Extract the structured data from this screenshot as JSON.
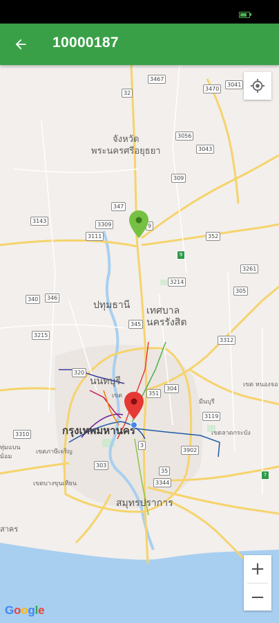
{
  "app_bar": {
    "title": "10000187",
    "back_icon": "arrow-back-icon",
    "color": "#3aa047"
  },
  "map": {
    "province_label": [
      "จังหวัด",
      "พระนครศรีอยุธยา"
    ],
    "city_labels": {
      "pathum_thani": "ปทุมธานี",
      "nakhon_rangsit": [
        "เทศบาล",
        "นครรังสิต"
      ],
      "nonthaburi": "นนทบุรี",
      "bangkok": "กรุงเทพมหานคร",
      "samut_prakan": "สมุทรปราการ",
      "phasi_charoen": "เขตภาษีเจริญ",
      "bang_khun_thian": "เขตบางขุนเทียน",
      "krathum_baen": [
        "ทุ่มแบน",
        "ม้อม"
      ],
      "sakhon": "สาคร",
      "nong_chok": "เขต หนองจอ",
      "lat_krabang": "เขตลาดกระบัง",
      "min_buri": "มีนบุรี",
      "bang_bua": "เขต"
    },
    "road_shields": [
      "3467",
      "3470",
      "3041",
      "32",
      "3056",
      "3043",
      "309",
      "347",
      "3309",
      "3111",
      "3143",
      "9",
      "352",
      "9",
      "3214",
      "3261",
      "305",
      "340",
      "346",
      "345",
      "3215",
      "3312",
      "320",
      "351",
      "304",
      "3119",
      "3310",
      "3902",
      "303",
      "3344",
      "35",
      "7",
      "3"
    ],
    "pins": [
      {
        "name": "green-pin",
        "color": "#76c043"
      },
      {
        "name": "red-pin",
        "color": "#e53935"
      }
    ],
    "current_location_color": "#4285f4"
  },
  "controls": {
    "my_location_icon": "crosshair-icon",
    "zoom_in": "+",
    "zoom_out": "−"
  },
  "attribution": {
    "letters": [
      "G",
      "o",
      "o",
      "g",
      "l",
      "e"
    ]
  }
}
